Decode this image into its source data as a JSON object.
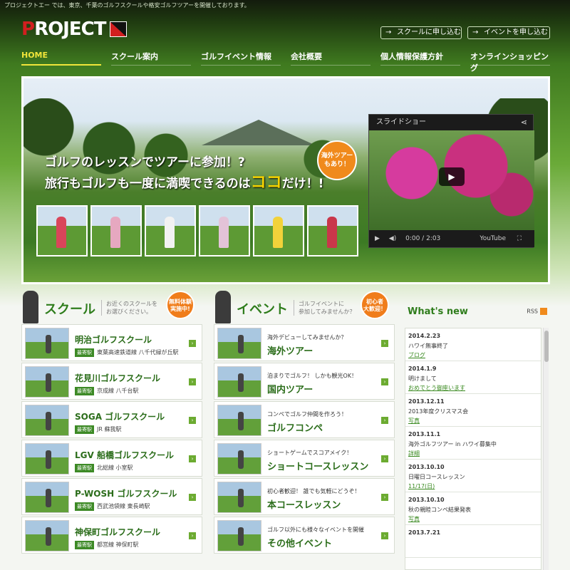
{
  "header": {
    "tagline": "プロジェクトエー では、東京、千葉のゴルフスクールや格安ゴルフツアーを開催しております。",
    "logo_text": "PROJECT",
    "logo_first": "P",
    "btn_school": "スクールに申し込む",
    "btn_event": "イベントを申し込む"
  },
  "nav": [
    "HOME",
    "スクール案内",
    "ゴルフイベント情報",
    "会社概要",
    "個人情報保護方針",
    "オンラインショッピング"
  ],
  "hero": {
    "line1": "ゴルフのレッスンでツアーに参加！?",
    "line2_a": "旅行もゴルフも一度に満喫できるのは",
    "line2_hl": "ココ",
    "line2_b": "だけ！!",
    "badge": "海外ツアー\nもあり！",
    "video": {
      "title": "スライドショー",
      "time": "0:00 / 2:03",
      "brand": "YouTube"
    }
  },
  "school": {
    "title": "スクール",
    "desc": "お近くのスクールを\nお選びください。",
    "badge": "無料体験\n実施中!",
    "station_label": "最寄駅",
    "items": [
      {
        "name": "明治ゴルフスクール",
        "station": "東葉高速鉄道線 八千代緑が丘駅"
      },
      {
        "name": "花見川ゴルフスクール",
        "station": "京成線 八千台駅"
      },
      {
        "name": "SOGA ゴルフスクール",
        "station": "JR 蘇我駅"
      },
      {
        "name": "LGV 船橋ゴルフスクール",
        "station": "北総線 小室駅"
      },
      {
        "name": "P-WOSH ゴルフスクール",
        "station": "西武池袋線 東長崎駅"
      },
      {
        "name": "神保町ゴルフスクール",
        "station": "都営線 神保町駅"
      }
    ]
  },
  "event": {
    "title": "イベント",
    "desc": "ゴルフイベントに\n参加してみませんか？",
    "badge": "初心者\n大歓迎！",
    "items": [
      {
        "desc": "海外デビューしてみませんか？",
        "name": "海外ツアー"
      },
      {
        "desc": "泊まりでゴルフ！ しかも観光OK！",
        "name": "国内ツアー"
      },
      {
        "desc": "コンペでゴルフ仲間を作ろう！",
        "name": "ゴルフコンペ"
      },
      {
        "desc": "ショートゲームでスコアメイク！",
        "name": "ショートコースレッスン"
      },
      {
        "desc": "初心者歓迎！ 誰でも気軽にどうぞ！",
        "name": "本コースレッスン"
      },
      {
        "desc": "ゴルフ以外にも様々なイベントを開催",
        "name": "その他イベント"
      }
    ]
  },
  "news": {
    "title": "What's new",
    "rss": "RSS",
    "items": [
      {
        "date": "2014.2.23",
        "title": "ハワイ無事終了",
        "link": "ブログ"
      },
      {
        "date": "2014.1.9",
        "title": "明けまして",
        "link": "おめでとう御座います"
      },
      {
        "date": "2013.12.11",
        "title": "2013年度クリスマス会",
        "link": "写真"
      },
      {
        "date": "2013.11.1",
        "title": "海外ゴルフツアー in ハワイ募集中",
        "link": "詳細"
      },
      {
        "date": "2013.10.10",
        "title": "日曜日コースレッスン",
        "link": "11/17(日)"
      },
      {
        "date": "2013.10.10",
        "title": "秋の親睦コンペ結果発表",
        "link": "写真"
      },
      {
        "date": "2013.7.21",
        "title": "",
        "link": ""
      }
    ]
  }
}
